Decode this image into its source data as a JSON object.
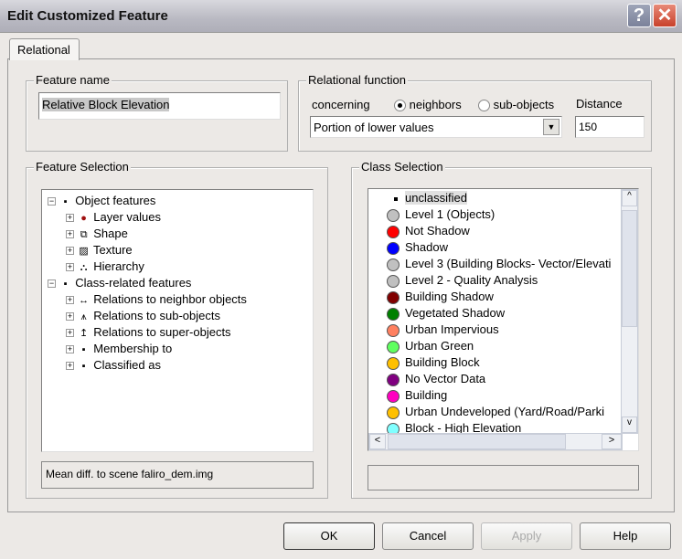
{
  "window": {
    "title": "Edit Customized Feature",
    "help": "?",
    "close": "✕"
  },
  "tab": "Relational",
  "feature_name": {
    "label": "Feature name",
    "value": "Relative Block Elevation"
  },
  "relational_function": {
    "label": "Relational function",
    "concerning_label": "concerning",
    "radio_neighbors": "neighbors",
    "radio_subobjects": "sub-objects",
    "selected": "neighbors",
    "distance_label": "Distance",
    "distance_value": "150",
    "function_value": "Portion of lower values"
  },
  "feature_selection": {
    "label": "Feature Selection",
    "items": [
      {
        "label": "Object features",
        "level": 0,
        "expander": "−",
        "icon": "square"
      },
      {
        "label": "Layer values",
        "level": 1,
        "expander": "+",
        "icon": "layer"
      },
      {
        "label": "Shape",
        "level": 1,
        "expander": "+",
        "icon": "shape"
      },
      {
        "label": "Texture",
        "level": 1,
        "expander": "+",
        "icon": "texture"
      },
      {
        "label": "Hierarchy",
        "level": 1,
        "expander": "+",
        "icon": "hierarchy"
      },
      {
        "label": "Class-related features",
        "level": 0,
        "expander": "−",
        "icon": "square"
      },
      {
        "label": "Relations to neighbor objects",
        "level": 1,
        "expander": "+",
        "icon": "neighbor"
      },
      {
        "label": "Relations to sub-objects",
        "level": 1,
        "expander": "+",
        "icon": "sub"
      },
      {
        "label": "Relations to super-objects",
        "level": 1,
        "expander": "+",
        "icon": "super"
      },
      {
        "label": "Membership to",
        "level": 1,
        "expander": "+",
        "icon": "square"
      },
      {
        "label": "Classified as",
        "level": 1,
        "expander": "+",
        "icon": "square"
      }
    ],
    "selected_feature": "Mean diff. to scene faliro_dem.img"
  },
  "class_selection": {
    "label": "Class Selection",
    "items": [
      {
        "label": "unclassified",
        "color": null
      },
      {
        "label": "Level 1 (Objects)",
        "color": "#c0c0c0"
      },
      {
        "label": "Not Shadow",
        "color": "#ff0000"
      },
      {
        "label": "Shadow",
        "color": "#0000ff"
      },
      {
        "label": "Level 3 (Building Blocks- Vector/Elevati",
        "color": "#c0c0c0"
      },
      {
        "label": "Level 2 - Quality Analysis",
        "color": "#c0c0c0"
      },
      {
        "label": "Building Shadow",
        "color": "#800000"
      },
      {
        "label": "Vegetated Shadow",
        "color": "#008000"
      },
      {
        "label": "Urban Impervious",
        "color": "#ff8060"
      },
      {
        "label": "Urban Green",
        "color": "#60ff60"
      },
      {
        "label": "Building Block",
        "color": "#ffc000"
      },
      {
        "label": "No Vector Data",
        "color": "#800080"
      },
      {
        "label": "Building",
        "color": "#ff00c0"
      },
      {
        "label": "Urban Undeveloped (Yard/Road/Parki",
        "color": "#ffc000"
      },
      {
        "label": "Block - High Elevation",
        "color": "#80ffff"
      }
    ],
    "selected_class": ""
  },
  "buttons": {
    "ok": "OK",
    "cancel": "Cancel",
    "apply": "Apply",
    "help": "Help"
  }
}
